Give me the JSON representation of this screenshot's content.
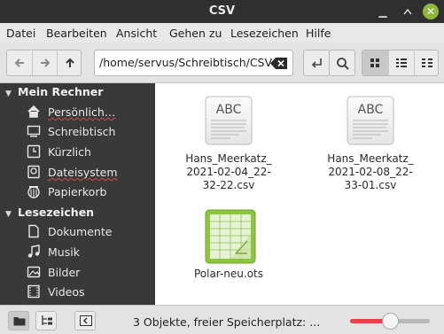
{
  "window": {
    "title": "CSV"
  },
  "menubar": {
    "items": [
      "Datei",
      "Bearbeiten",
      "Ansicht",
      "Gehen zu",
      "Lesezeichen",
      "Hilfe"
    ]
  },
  "toolbar": {
    "path": "/home/servus/Schreibtisch/CSV"
  },
  "sidebar": {
    "sections": [
      {
        "title": "Mein Rechner",
        "items": [
          {
            "label": "Persönlich…",
            "icon": "home-icon"
          },
          {
            "label": "Schreibtisch",
            "icon": "desktop-icon"
          },
          {
            "label": "Kürzlich",
            "icon": "recent-icon"
          },
          {
            "label": "Dateisystem",
            "icon": "drive-icon"
          },
          {
            "label": "Papierkorb",
            "icon": "trash-icon"
          }
        ]
      },
      {
        "title": "Lesezeichen",
        "items": [
          {
            "label": "Dokumente",
            "icon": "documents-icon"
          },
          {
            "label": "Musik",
            "icon": "music-icon"
          },
          {
            "label": "Bilder",
            "icon": "pictures-icon"
          },
          {
            "label": "Videos",
            "icon": "videos-icon"
          }
        ]
      }
    ]
  },
  "files": [
    {
      "name_lines": [
        "Hans_Meerkatz_",
        "2021-02-04_22-",
        "32-22.csv"
      ],
      "icon": "text-document-icon",
      "icon_text": "ABC"
    },
    {
      "name_lines": [
        "Hans_Meerkatz_",
        "2021-02-08_22-",
        "33-01.csv"
      ],
      "icon": "text-document-icon",
      "icon_text": "ABC"
    },
    {
      "name_lines": [
        "Polar-neu.ots"
      ],
      "icon": "spreadsheet-template-icon"
    }
  ],
  "statusbar": {
    "text": "3 Objekte, freier Speicherplatz: ...",
    "zoom_level": 0.5
  },
  "colors": {
    "accent": "#8fb73b",
    "slider": "#e0474c",
    "sidebar_bg": "#393939"
  }
}
